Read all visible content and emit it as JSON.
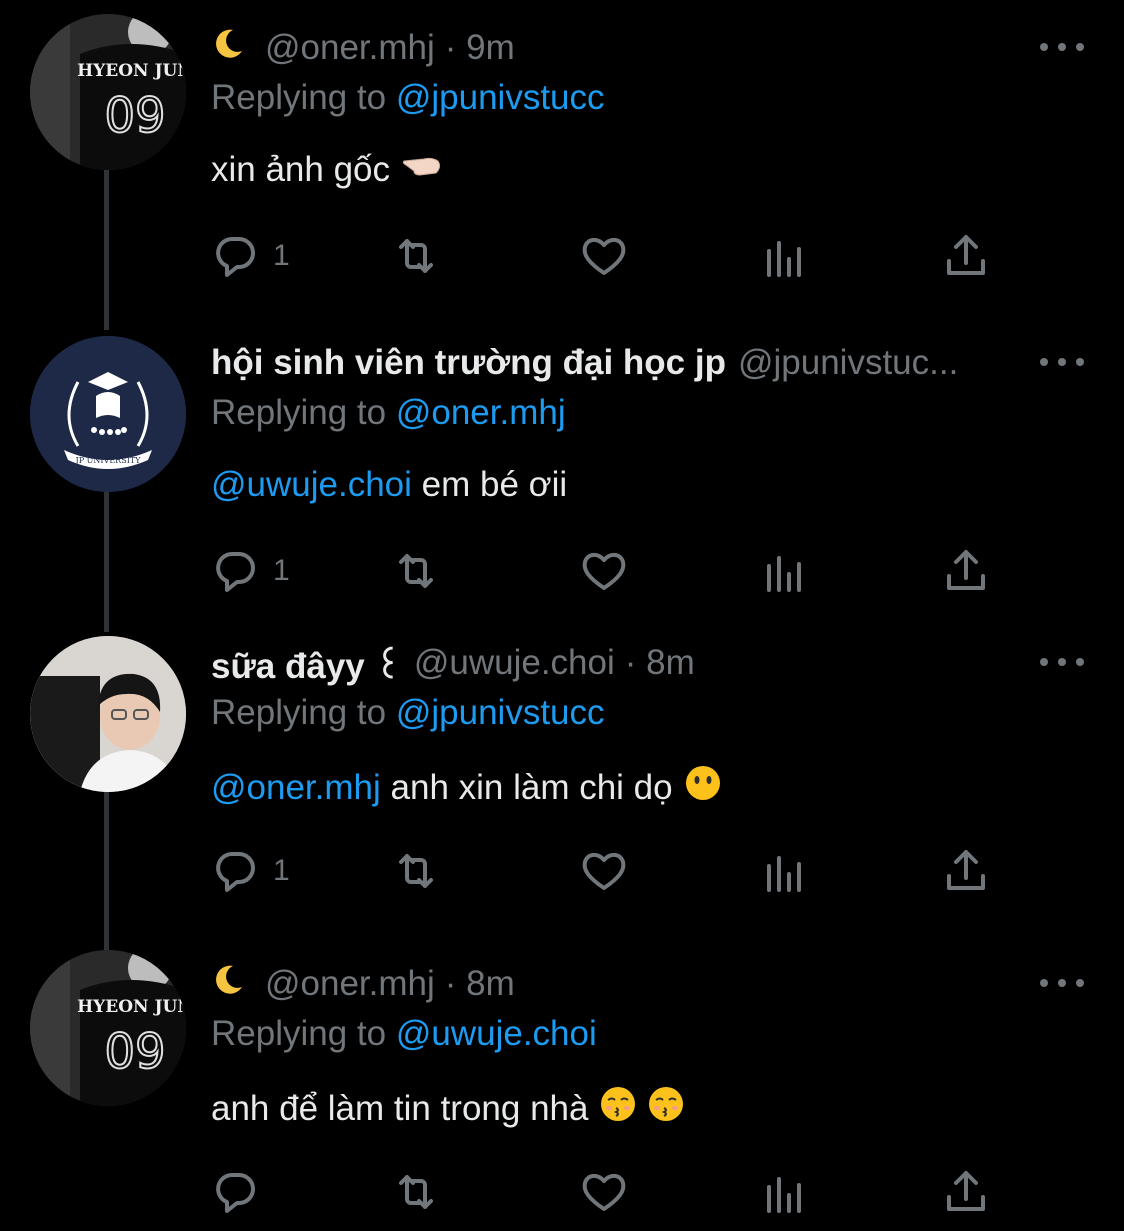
{
  "tweets": [
    {
      "prefix_icon": "crescent-moon-icon",
      "name": "",
      "handle": "@oner.mhj",
      "time": "· 9m",
      "replying_label": "Replying to",
      "replying_to": "@jpunivstucc",
      "mention": "",
      "text": "xin ảnh gốc",
      "emoji": "backhand-index-pointing-left-emoji",
      "reply_count": "1",
      "avatar": {
        "jersey_name": "HYEON JUN",
        "jersey_number": "09"
      }
    },
    {
      "prefix_icon": "",
      "name": "hội sinh viên trường đại học jp",
      "handle": "@jpunivstuc...",
      "time": "",
      "replying_label": "Replying to",
      "replying_to": "@oner.mhj",
      "mention": "@uwuje.choi",
      "text": "em bé ơii",
      "reply_count": "1",
      "avatar": {
        "logo_text": "JP UNIVERSITY"
      }
    },
    {
      "prefix_icon": "",
      "name": "sữa đâyy ꒰",
      "handle": "@uwuje.choi",
      "time": "· 8m",
      "replying_label": "Replying to",
      "replying_to": "@jpunivstucc",
      "mention": "@oner.mhj",
      "text": "anh xin làm chi dọ",
      "emoji": "face-without-mouth-emoji",
      "reply_count": "1"
    },
    {
      "prefix_icon": "crescent-moon-icon",
      "name": "",
      "handle": "@oner.mhj",
      "time": "· 8m",
      "replying_label": "Replying to",
      "replying_to": "@uwuje.choi",
      "mention": "",
      "text": "anh để làm tin trong nhà",
      "emoji": "kissing-face-emoji",
      "reply_count": "",
      "avatar": {
        "jersey_name": "HYEON JUN",
        "jersey_number": "09"
      }
    }
  ],
  "colors": {
    "background": "#000000",
    "link": "#1d9bf0",
    "muted": "#71767b",
    "text": "#e7e9ea"
  }
}
